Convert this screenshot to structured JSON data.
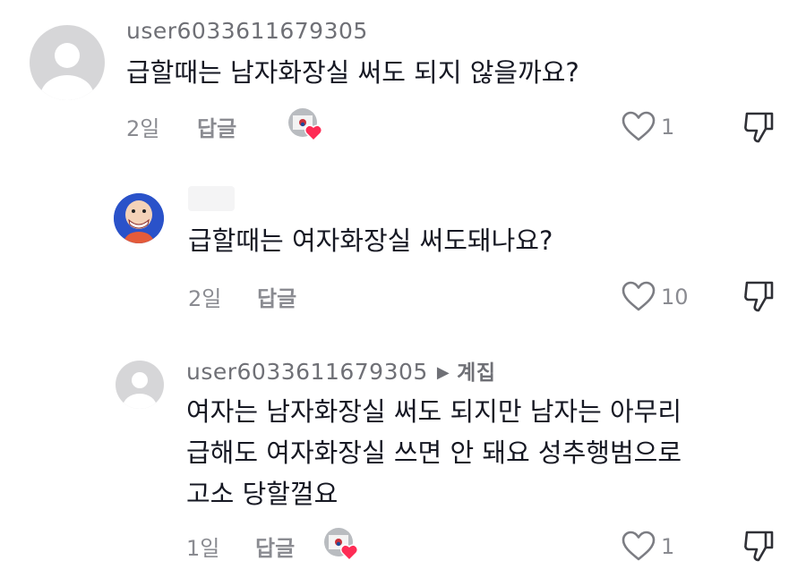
{
  "comments": [
    {
      "username": "user6033611679305",
      "text": "급할때는 남자화장실 써도 되지 않을까요?",
      "time": "2일",
      "reply_label": "답글",
      "likes": "1"
    },
    {
      "username": "",
      "text": "급할때는 여자화장실 써도돼나요?",
      "time": "2일",
      "reply_label": "답글",
      "likes": "10"
    },
    {
      "username": "user6033611679305",
      "reply_to": "계집",
      "text_lines": [
        "여자는 남자화장실 써도 되지만 남자는 아무리",
        "급해도 여자화장실 쓰면 안 돼요 성추행범으로",
        "고소 당할껄요"
      ],
      "time": "1일",
      "reply_label": "답글",
      "likes": "1"
    }
  ],
  "icons": {
    "like": "heart-outline-icon",
    "dislike": "thumbs-down-icon",
    "creator_liked": "creator-liked-badge-icon",
    "reply_arrow": "right-triangle-icon"
  },
  "colors": {
    "heart_badge": "#fe2c55",
    "muted_text": "#8a8b91",
    "username": "#6f7076"
  }
}
